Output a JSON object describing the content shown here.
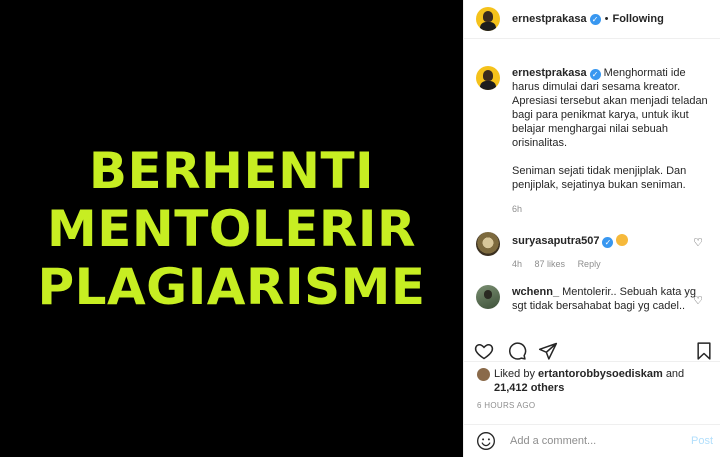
{
  "media": {
    "lines": [
      "BERHENTI",
      "MENTOLERIR",
      "PLAGIARISME"
    ],
    "text_color": "#c7ee22",
    "background": "#000000"
  },
  "header": {
    "username": "ernestprakasa",
    "separator": "•",
    "follow_status": "Following"
  },
  "caption": {
    "username": "ernestprakasa",
    "paragraph1": "Menghormati ide harus dimulai dari sesama kreator. Apresiasi tersebut akan menjadi teladan bagi para penikmat karya, untuk ikut belajar menghargai nilai sebuah orisinalitas.",
    "paragraph2": "Seniman sejati tidak menjiplak. Dan penjiplak, sejatinya bukan seniman.",
    "time": "6h"
  },
  "comments": [
    {
      "username": "suryasaputra507",
      "text": "",
      "time": "4h",
      "likes": "87 likes",
      "reply": "Reply"
    },
    {
      "username": "wchenn_",
      "text": "Mentolerir.. Sebuah kata yg sgt tidak bersahabat bagi yg cadel.."
    }
  ],
  "likes": {
    "prefix": "Liked by",
    "user": "ertantorobbysoediskam",
    "and": "and",
    "others": "21,412 others"
  },
  "timestamp": "6 HOURS AGO",
  "comment_box": {
    "placeholder": "Add a comment...",
    "post_label": "Post"
  },
  "icons": {
    "like": "heart-icon",
    "comment": "comment-icon",
    "share": "share-icon",
    "save": "bookmark-icon",
    "emoji": "emoji-icon"
  },
  "colors": {
    "verified": "#3897f0",
    "secondary_text": "#8e8e8e",
    "post_button": "#b2dffc"
  }
}
